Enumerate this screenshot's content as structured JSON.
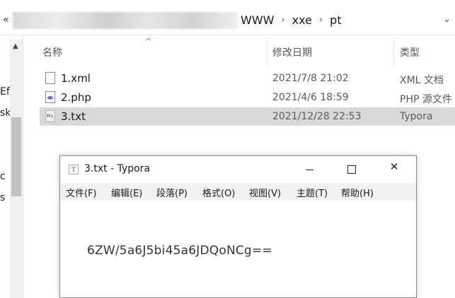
{
  "address_bar": {
    "crumbs": [
      "WWW",
      "xxe",
      "pt"
    ],
    "back_chevron": "«",
    "separator": "›",
    "dropdown": "⌄"
  },
  "nav_fragments": [
    "Ef",
    "sk",
    "c",
    "s"
  ],
  "columns": {
    "name": "名称",
    "date": "修改日期",
    "type": "类型",
    "sort": "^"
  },
  "files": [
    {
      "name": "1.xml",
      "date": "2021/7/8 21:02",
      "type": "XML 文档",
      "icon": "xml-file-icon",
      "selected": false
    },
    {
      "name": "2.php",
      "date": "2021/4/6 18:59",
      "type": "PHP 源文件",
      "icon": "php-file-icon",
      "selected": false
    },
    {
      "name": "3.txt",
      "date": "2021/12/28 22:53",
      "type": "Typora",
      "icon": "txt-file-icon",
      "selected": true
    }
  ],
  "typora": {
    "title": "3.txt - Typora",
    "menus": [
      "文件(F)",
      "编辑(E)",
      "段落(P)",
      "格式(O)",
      "视图(V)",
      "主题(T)",
      "帮助(H)"
    ],
    "content": "6ZW/5a6J5bi45a6JDQoNCg==",
    "close_glyph": "✕"
  }
}
